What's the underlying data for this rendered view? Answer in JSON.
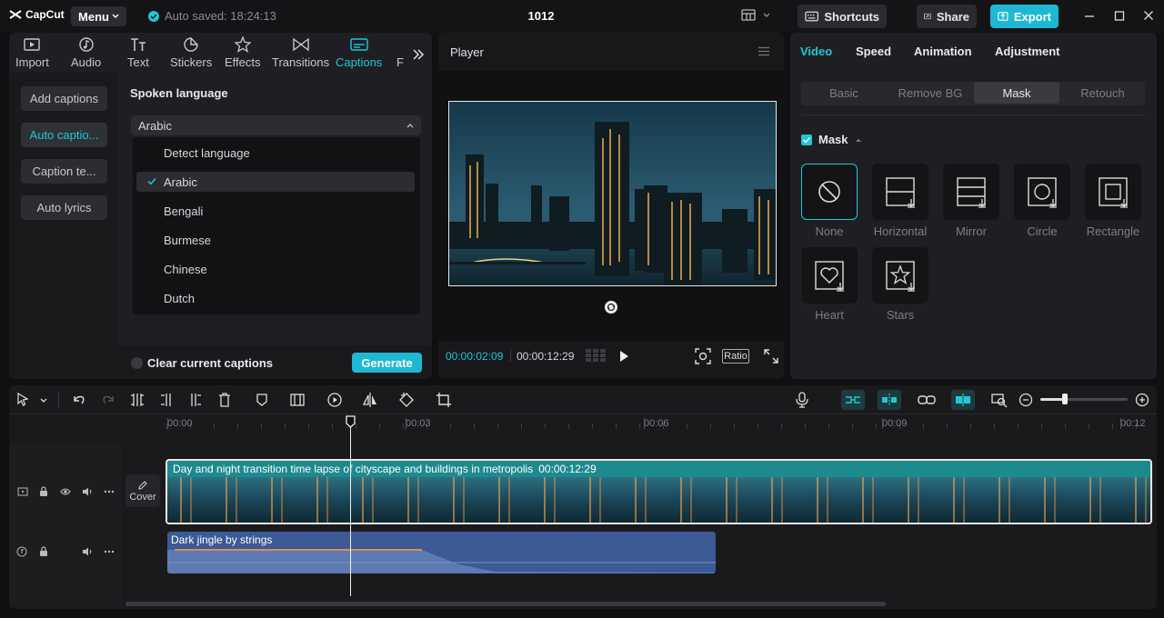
{
  "app": {
    "logo_text": "CapCut",
    "menu_label": "Menu",
    "autosave_text": "Auto saved: 18:24:13",
    "project_title": "1012",
    "shortcuts_label": "Shortcuts",
    "share_label": "Share",
    "export_label": "Export"
  },
  "colors": {
    "accent": "#1fc8d6",
    "panel": "#1f1f23",
    "bg": "#101012",
    "clip": "#1d8a8f",
    "audio": "#3b5a96"
  },
  "left_tabs": [
    {
      "label": "Import",
      "icon": "import-icon"
    },
    {
      "label": "Audio",
      "icon": "audio-icon"
    },
    {
      "label": "Text",
      "icon": "text-icon"
    },
    {
      "label": "Stickers",
      "icon": "stickers-icon"
    },
    {
      "label": "Effects",
      "icon": "effects-icon"
    },
    {
      "label": "Transitions",
      "icon": "transitions-icon"
    },
    {
      "label": "Captions",
      "icon": "captions-icon",
      "active": true
    },
    {
      "label": "F",
      "icon": ""
    }
  ],
  "captions_menu": [
    "Add captions",
    "Auto captio...",
    "Caption te...",
    "Auto lyrics"
  ],
  "spoken_language": {
    "heading": "Spoken language",
    "selected": "Arabic",
    "options": [
      "Detect language",
      "Arabic",
      "Bengali",
      "Burmese",
      "Chinese",
      "Dutch"
    ],
    "clear_label": "Clear current captions",
    "generate_label": "Generate"
  },
  "player": {
    "title": "Player",
    "current_time": "00:00:02:09",
    "total_time": "00:00:12:29",
    "ratio_label": "Ratio"
  },
  "right_panel": {
    "tabs": [
      "Video",
      "Speed",
      "Animation",
      "Adjustment"
    ],
    "subtabs": [
      "Basic",
      "Remove BG",
      "Mask",
      "Retouch"
    ],
    "mask_heading": "Mask",
    "masks": [
      "None",
      "Horizontal",
      "Mirror",
      "Circle",
      "Rectangle",
      "Heart",
      "Stars"
    ]
  },
  "timeline": {
    "ruler": [
      "00:00",
      "00:03",
      "00:06",
      "00:09",
      "00:12"
    ],
    "cover_label": "Cover",
    "video_clip_title": "Day and night transition time lapse of cityscape and buildings in metropolis",
    "video_clip_duration": "00:00:12:29",
    "audio_clip_title": "Dark jingle by strings",
    "playhead_fraction": 0.184
  }
}
